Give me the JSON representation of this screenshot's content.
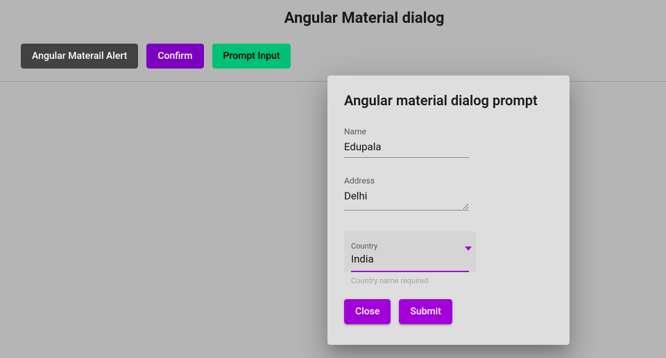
{
  "header": {
    "title": "Angular Material dialog",
    "buttons": {
      "alert": "Angular Materail Alert",
      "confirm": "Confirm",
      "prompt": "Prompt Input"
    }
  },
  "dialog": {
    "title": "Angular material dialog prompt",
    "fields": {
      "name": {
        "label": "Name",
        "value": "Edupala"
      },
      "address": {
        "label": "Address",
        "value": "Delhi"
      },
      "country": {
        "label": "Country",
        "value": "India",
        "hint": "Country name required"
      }
    },
    "actions": {
      "close": "Close",
      "submit": "Submit"
    }
  }
}
